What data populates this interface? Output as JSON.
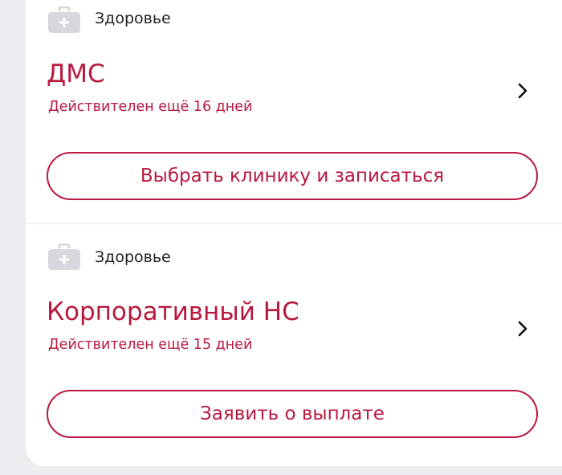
{
  "colors": {
    "accent": "#b8193f",
    "icon": "#d6d8de",
    "text": "#222222"
  },
  "products": [
    {
      "category_icon": "first-aid-kit-icon",
      "category": "Здоровье",
      "title": "ДМС",
      "status": "Действителен ещё 16 дней",
      "action_label": "Выбрать клинику и записаться"
    },
    {
      "category_icon": "first-aid-kit-icon",
      "category": "Здоровье",
      "title": "Корпоративный НС",
      "status": "Действителен ещё 15 дней",
      "action_label": "Заявить о выплате"
    }
  ]
}
